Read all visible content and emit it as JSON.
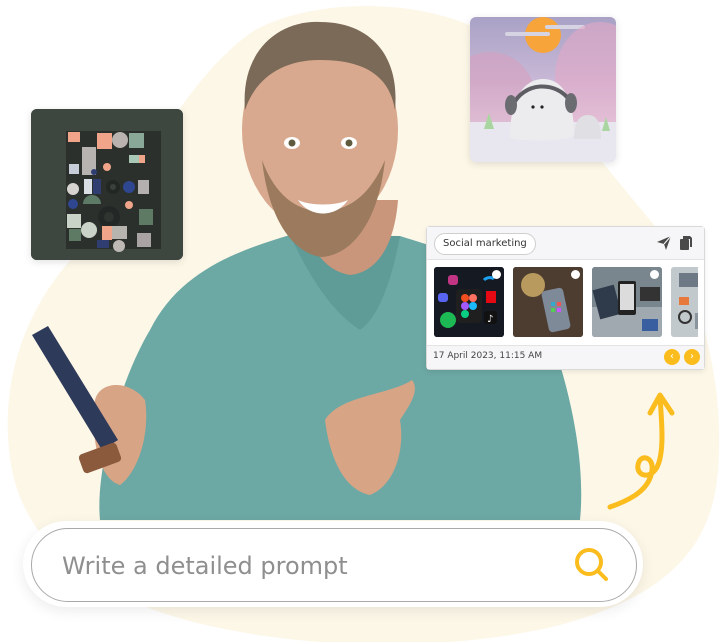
{
  "colors": {
    "accent": "#fbbc1e",
    "blob": "#fdf7e8",
    "sweater": "#6fa9a5"
  },
  "images": {
    "left_tile": "abstract-3d-blocks-artwork",
    "right_tile": "cute-character-with-headphones-artwork",
    "person": "smiling-man-holding-phone"
  },
  "card": {
    "chip_label": "Social marketing",
    "send_icon": "send-icon",
    "copy_icon": "copy-icon",
    "thumbnails": [
      {
        "name": "social-app-icons"
      },
      {
        "name": "phone-on-table"
      },
      {
        "name": "hand-holding-phone"
      },
      {
        "name": "desk-workspace"
      }
    ],
    "date": "17 April 2023, 11:15 AM",
    "prev_label": "‹",
    "next_label": "›"
  },
  "search": {
    "placeholder": "Write a detailed prompt",
    "value": "",
    "icon": "search-icon"
  }
}
